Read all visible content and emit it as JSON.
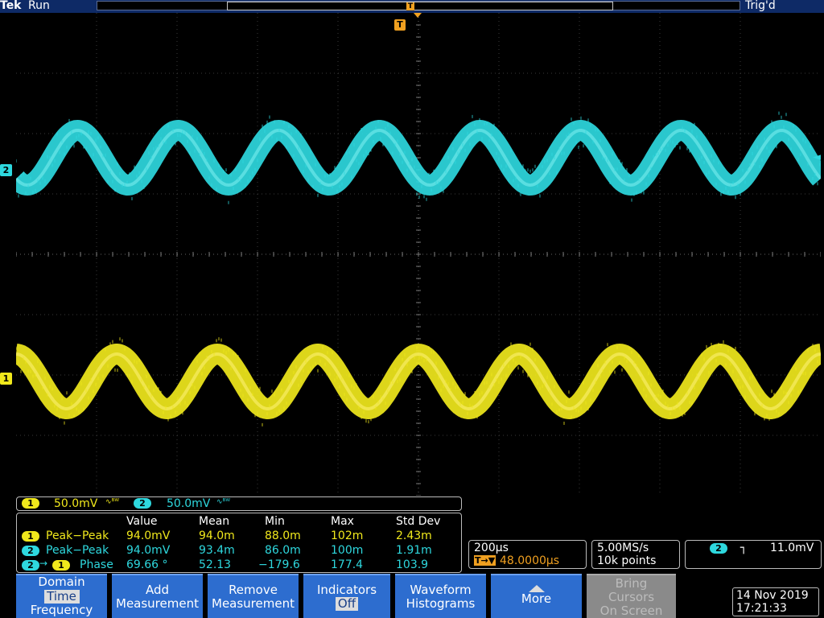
{
  "header": {
    "brand": "Tek",
    "acq_state": "Run",
    "trigger_status": "Trig'd",
    "trigger_marker": "T"
  },
  "markers": {
    "ch2": "2",
    "ch1": "1",
    "trigger_level_arrow": "◄"
  },
  "channel_bar": {
    "ch1_num": "1",
    "ch1_scale": "50.0mV",
    "ch1_bw": "∿ᴮᵂ",
    "ch2_num": "2",
    "ch2_scale": "50.0mV",
    "ch2_bw": "∿ᴮᵂ"
  },
  "measurements": {
    "headers": [
      "Value",
      "Mean",
      "Min",
      "Max",
      "Std Dev"
    ],
    "rows": [
      {
        "src": "1",
        "label": "Peak−Peak",
        "value": "94.0mV",
        "mean": "94.0m",
        "min": "88.0m",
        "max": "102m",
        "std": "2.43m"
      },
      {
        "src": "2",
        "label": "Peak−Peak",
        "value": "94.0mV",
        "mean": "93.4m",
        "min": "86.0m",
        "max": "100m",
        "std": "1.91m"
      },
      {
        "src": "2",
        "src2": "1",
        "arrow": "→",
        "label": "Phase",
        "value": "69.66 °",
        "mean": "52.13",
        "min": "−179.6",
        "max": "177.4",
        "std": "103.9"
      }
    ]
  },
  "timebase": {
    "scale": "200μs",
    "position_icon": "T→▼",
    "position": "48.0000μs"
  },
  "sampling": {
    "rate": "5.00MS/s",
    "points": "10k points"
  },
  "trigger": {
    "source": "2",
    "slope_icon": "┐",
    "level": "11.0mV"
  },
  "menu": {
    "domain_title": "Domain",
    "domain_time": "Time",
    "domain_freq": "Frequency",
    "add_line1": "Add",
    "add_line2": "Measurement",
    "remove_line1": "Remove",
    "remove_line2": "Measurement",
    "indicators_line1": "Indicators",
    "indicators_value": "Off",
    "histo_line1": "Waveform",
    "histo_line2": "Histograms",
    "more_label": "More",
    "bring_line1": "Bring",
    "bring_line2": "Cursors",
    "bring_line3": "On Screen"
  },
  "datetime": {
    "date": "14 Nov 2019",
    "time": "17:21:33"
  },
  "colors": {
    "ch1": "#f0e81c",
    "ch2": "#2ed8de",
    "menu_blue": "#2d6dcf",
    "trigger_orange": "#f0a020"
  },
  "waveforms": {
    "ch1": {
      "cycles": 8,
      "phase_deg": 0,
      "noise_band": "thick"
    },
    "ch2": {
      "cycles": 8,
      "phase_deg": 70,
      "noise_band": "thick"
    }
  }
}
